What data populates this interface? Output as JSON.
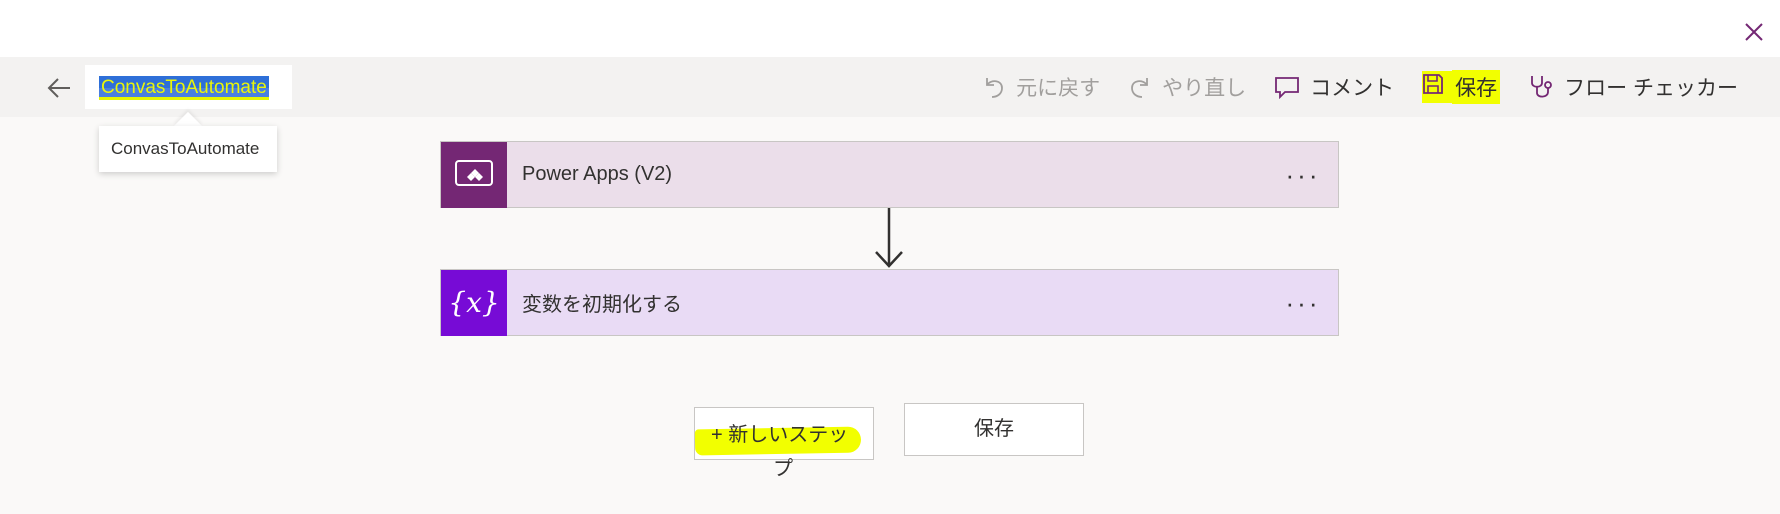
{
  "window": {
    "close_icon": "close-icon"
  },
  "header": {
    "back_icon": "back-arrow-icon",
    "flow_name": "ConvasToAutomate",
    "tooltip": "ConvasToAutomate",
    "commands": [
      {
        "label": "元に戻す",
        "icon": "undo-icon",
        "enabled": false
      },
      {
        "label": "やり直し",
        "icon": "redo-icon",
        "enabled": false
      },
      {
        "label": "コメント",
        "icon": "comment-icon",
        "enabled": true
      },
      {
        "label": "保存",
        "icon": "save-icon",
        "enabled": true
      },
      {
        "label": "フロー チェッカー",
        "icon": "stethoscope-icon",
        "enabled": true
      }
    ]
  },
  "steps": [
    {
      "title": "Power Apps (V2)",
      "icon": "power-apps-icon",
      "color": "#742774",
      "more": "..."
    },
    {
      "title": "変数を初期化する",
      "icon": "variable-icon",
      "icon_text": "{x}",
      "color": "#770bd6",
      "more": "..."
    }
  ],
  "actions": {
    "new_step_line1": "+ 新しいステッ",
    "new_step_line2": "プ",
    "save": "保存"
  },
  "colors": {
    "highlight": "#f2ff00",
    "selection": "#2e6fd8",
    "accent": "#742774"
  }
}
